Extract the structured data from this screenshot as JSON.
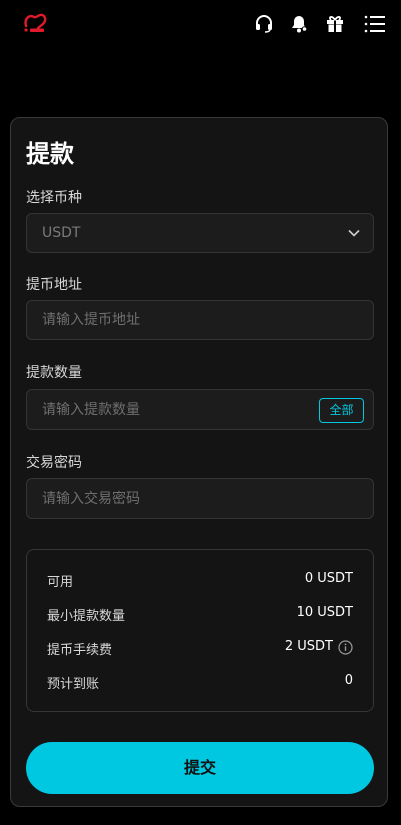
{
  "header": {
    "logo": "bitdo-logo",
    "icons": [
      "headset-icon",
      "bell-icon",
      "gift-icon",
      "menu-icon"
    ]
  },
  "form": {
    "title": "提款",
    "currency_label": "选择币种",
    "currency_value": "USDT",
    "address_label": "提币地址",
    "address_placeholder": "请输入提币地址",
    "amount_label": "提款数量",
    "amount_placeholder": "请输入提款数量",
    "all_button": "全部",
    "password_label": "交易密码",
    "password_placeholder": "请输入交易密码"
  },
  "summary": {
    "available_label": "可用",
    "available_value": "0 USDT",
    "min_label": "最小提款数量",
    "min_value": "10 USDT",
    "fee_label": "提币手续费",
    "fee_value": "2 USDT",
    "estimate_label": "预计到账",
    "estimate_value": "0"
  },
  "submit_label": "提交",
  "colors": {
    "accent": "#00c8e0",
    "brand": "#e0192b"
  }
}
